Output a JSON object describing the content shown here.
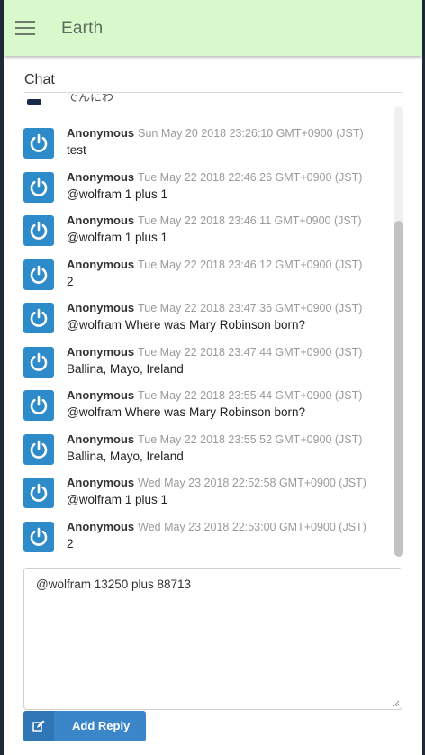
{
  "appbar": {
    "title": "Earth",
    "menu_icon": "hamburger-menu-icon"
  },
  "chat": {
    "heading": "Chat",
    "partial_text": "でんにわ",
    "messages": [
      {
        "author": "Anonymous",
        "time": "Sun May 20 2018 23:26:10 GMT+0900 (JST)",
        "text": "test"
      },
      {
        "author": "Anonymous",
        "time": "Tue May 22 2018 22:46:26 GMT+0900 (JST)",
        "text": "@wolfram 1 plus 1"
      },
      {
        "author": "Anonymous",
        "time": "Tue May 22 2018 23:46:11 GMT+0900 (JST)",
        "text": "@wolfram 1 plus 1"
      },
      {
        "author": "Anonymous",
        "time": "Tue May 22 2018 23:46:12 GMT+0900 (JST)",
        "text": "2"
      },
      {
        "author": "Anonymous",
        "time": "Tue May 22 2018 23:47:36 GMT+0900 (JST)",
        "text": "@wolfram Where was Mary Robinson born?"
      },
      {
        "author": "Anonymous",
        "time": "Tue May 22 2018 23:47:44 GMT+0900 (JST)",
        "text": "Ballina, Mayo, Ireland"
      },
      {
        "author": "Anonymous",
        "time": "Tue May 22 2018 23:55:44 GMT+0900 (JST)",
        "text": "@wolfram Where was Mary Robinson born?"
      },
      {
        "author": "Anonymous",
        "time": "Tue May 22 2018 23:55:52 GMT+0900 (JST)",
        "text": "Ballina, Mayo, Ireland"
      },
      {
        "author": "Anonymous",
        "time": "Wed May 23 2018 22:52:58 GMT+0900 (JST)",
        "text": "@wolfram 1 plus 1"
      },
      {
        "author": "Anonymous",
        "time": "Wed May 23 2018 22:53:00 GMT+0900 (JST)",
        "text": "2"
      }
    ]
  },
  "reply": {
    "value": "@wolfram 13250 plus 88713",
    "button_label": "Add Reply",
    "button_icon": "edit-icon"
  },
  "colors": {
    "appbar": "#d9f9cc",
    "avatar": "#2d8bc9",
    "button": "#3b86c9"
  }
}
